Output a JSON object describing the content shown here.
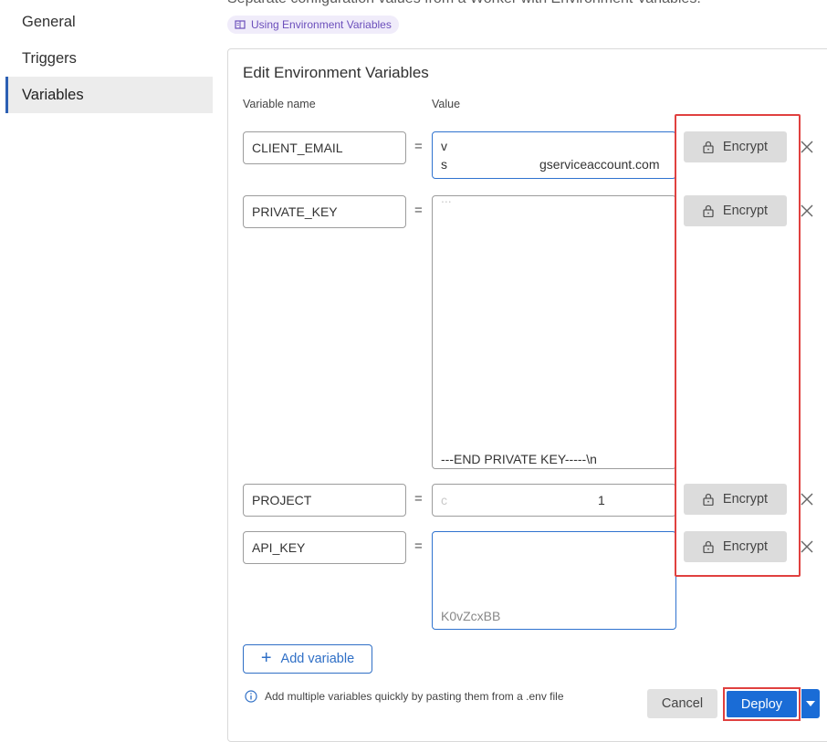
{
  "sidebar": {
    "items": [
      {
        "label": "General",
        "active": false
      },
      {
        "label": "Triggers",
        "active": false
      },
      {
        "label": "Variables",
        "active": true
      }
    ]
  },
  "header": {
    "description": "Separate configuration values from a Worker with Environment Variables.",
    "doc_link": "Using Environment Variables"
  },
  "panel": {
    "title": "Edit Environment Variables",
    "col_name": "Variable name",
    "col_value": "Value"
  },
  "variables": [
    {
      "name": "CLIENT_EMAIL",
      "value_line1": "v",
      "value_line2_start": "s",
      "value_line2_end": "gserviceaccount.com",
      "encrypt_label": "Encrypt"
    },
    {
      "name": "PRIVATE_KEY",
      "value_top": "...",
      "value_end": "---END PRIVATE KEY-----\\n",
      "encrypt_label": "Encrypt"
    },
    {
      "name": "PROJECT",
      "value_start": "c",
      "value_end": "1",
      "encrypt_label": "Encrypt"
    },
    {
      "name": "API_KEY",
      "value_end": "K0vZcxBB",
      "encrypt_label": "Encrypt"
    }
  ],
  "separator": "=",
  "add_variable_label": "Add variable",
  "hint": "Add multiple variables quickly by pasting them from a .env file",
  "cancel_label": "Cancel",
  "deploy_label": "Deploy",
  "colors": {
    "accent": "#1a6cd6",
    "highlight": "#e0403f",
    "link_purple": "#6b4fbb"
  },
  "icons": {
    "lock": "lock-icon",
    "remove": "close-icon",
    "info": "info-icon",
    "book": "book-icon",
    "dropdown": "chevron-down-icon"
  }
}
